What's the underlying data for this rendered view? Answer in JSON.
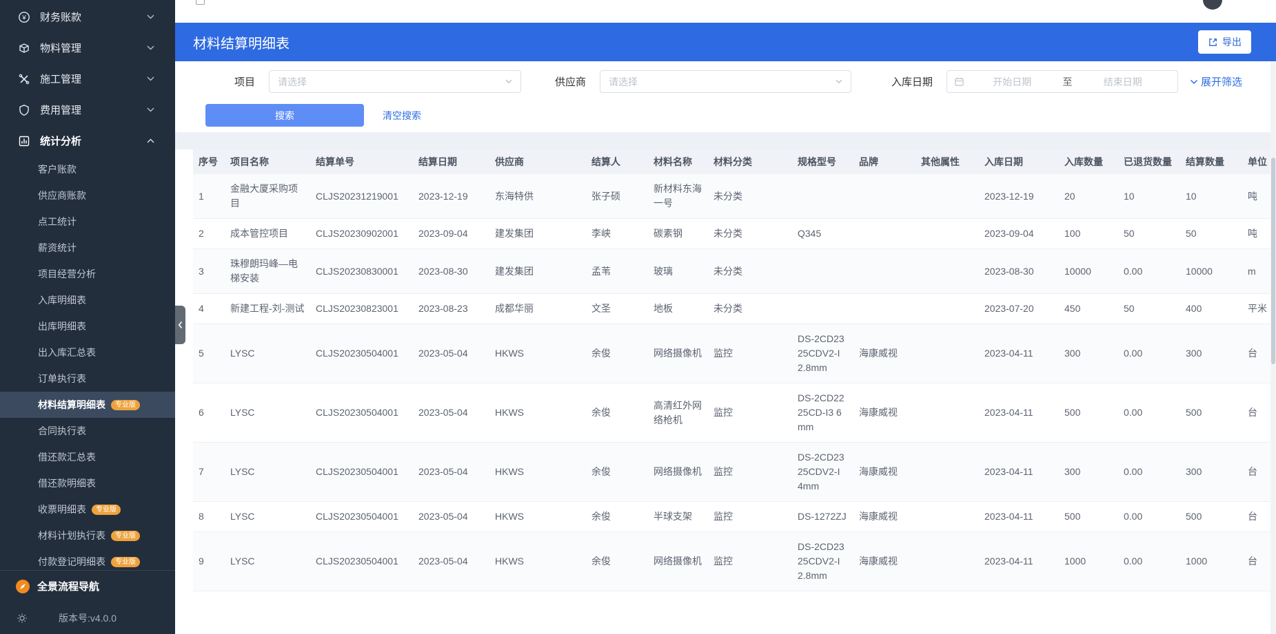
{
  "sidebar": {
    "menu": [
      {
        "label": "财务账款",
        "icon": "finance-icon"
      },
      {
        "label": "物料管理",
        "icon": "material-icon"
      },
      {
        "label": "施工管理",
        "icon": "construction-icon"
      },
      {
        "label": "费用管理",
        "icon": "expense-icon"
      },
      {
        "label": "统计分析",
        "icon": "stats-icon",
        "expanded": true
      }
    ],
    "submenu": [
      {
        "label": "客户账款"
      },
      {
        "label": "供应商账款"
      },
      {
        "label": "点工统计"
      },
      {
        "label": "薪资统计"
      },
      {
        "label": "项目经营分析"
      },
      {
        "label": "入库明细表"
      },
      {
        "label": "出库明细表"
      },
      {
        "label": "出入库汇总表"
      },
      {
        "label": "订单执行表"
      },
      {
        "label": "材料结算明细表",
        "badge": "专业版",
        "active": true
      },
      {
        "label": "合同执行表"
      },
      {
        "label": "借还款汇总表"
      },
      {
        "label": "借还款明细表"
      },
      {
        "label": "收票明细表",
        "badge": "专业版"
      },
      {
        "label": "材料计划执行表",
        "badge": "专业版"
      },
      {
        "label": "付款登记明细表",
        "badge": "专业版"
      }
    ],
    "footer_nav": "全景流程导航",
    "version": "版本号:v4.0.0"
  },
  "page": {
    "title": "材料结算明细表",
    "export_label": "导出"
  },
  "filters": {
    "project_label": "项目",
    "project_placeholder": "请选择",
    "supplier_label": "供应商",
    "supplier_placeholder": "请选择",
    "date_label": "入库日期",
    "date_start_placeholder": "开始日期",
    "date_to": "至",
    "date_end_placeholder": "结束日期",
    "expand_label": "展开筛选",
    "search_label": "搜索",
    "clear_label": "清空搜索"
  },
  "table": {
    "headers": [
      "序号",
      "项目名称",
      "结算单号",
      "结算日期",
      "供应商",
      "结算人",
      "材料名称",
      "材料分类",
      "规格型号",
      "品牌",
      "其他属性",
      "入库日期",
      "入库数量",
      "已退货数量",
      "结算数量",
      "单位"
    ],
    "rows": [
      [
        "1",
        "金融大厦采购项目",
        "CLJS20231219001",
        "2023-12-19",
        "东海特供",
        "张子硕",
        "新材料东海一号",
        "未分类",
        "",
        "",
        "",
        "2023-12-19",
        "20",
        "10",
        "10",
        "吨"
      ],
      [
        "2",
        "成本管控项目",
        "CLJS20230902001",
        "2023-09-04",
        "建发集团",
        "李峡",
        "碳素钢",
        "未分类",
        "Q345",
        "",
        "",
        "2023-09-04",
        "100",
        "50",
        "50",
        "吨"
      ],
      [
        "3",
        "珠穆朗玛峰—电梯安装",
        "CLJS20230830001",
        "2023-08-30",
        "建发集团",
        "孟苇",
        "玻璃",
        "未分类",
        "",
        "",
        "",
        "2023-08-30",
        "10000",
        "0.00",
        "10000",
        "m"
      ],
      [
        "4",
        "新建工程-刘-测试",
        "CLJS20230823001",
        "2023-08-23",
        "成都华丽",
        "文圣",
        "地板",
        "未分类",
        "",
        "",
        "",
        "2023-07-20",
        "450",
        "50",
        "400",
        "平米"
      ],
      [
        "5",
        "LYSC",
        "CLJS20230504001",
        "2023-05-04",
        "HKWS",
        "余俊",
        "网络摄像机",
        "监控",
        "DS-2CD2325CDV2-I 2.8mm",
        "海康威视",
        "",
        "2023-04-11",
        "300",
        "0.00",
        "300",
        "台"
      ],
      [
        "6",
        "LYSC",
        "CLJS20230504001",
        "2023-05-04",
        "HKWS",
        "余俊",
        "高清红外网络枪机",
        "监控",
        "DS-2CD2225CD-I3 6mm",
        "海康威视",
        "",
        "2023-04-11",
        "500",
        "0.00",
        "500",
        "台"
      ],
      [
        "7",
        "LYSC",
        "CLJS20230504001",
        "2023-05-04",
        "HKWS",
        "余俊",
        "网络摄像机",
        "监控",
        "DS-2CD2325CDV2-I 4mm",
        "海康威视",
        "",
        "2023-04-11",
        "300",
        "0.00",
        "300",
        "台"
      ],
      [
        "8",
        "LYSC",
        "CLJS20230504001",
        "2023-05-04",
        "HKWS",
        "余俊",
        "半球支架",
        "监控",
        "DS-1272ZJ",
        "海康威视",
        "",
        "2023-04-11",
        "500",
        "0.00",
        "500",
        "台"
      ],
      [
        "9",
        "LYSC",
        "CLJS20230504001",
        "2023-05-04",
        "HKWS",
        "余俊",
        "网络摄像机",
        "监控",
        "DS-2CD2325CDV2-I 2.8mm",
        "海康威视",
        "",
        "2023-04-11",
        "1000",
        "0.00",
        "1000",
        "台"
      ]
    ]
  }
}
